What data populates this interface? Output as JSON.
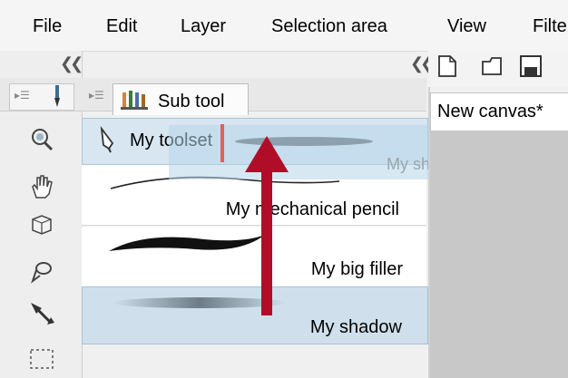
{
  "menu": {
    "file": "File",
    "edit": "Edit",
    "layer": "Layer",
    "selection_area": "Selection area",
    "view": "View",
    "filter": "Filte"
  },
  "subtool_panel": {
    "tab_label": "Sub tool",
    "toolset_label": "My toolset",
    "ghost_drag_label": "My shadow",
    "items": [
      {
        "label": "My mechanical pencil"
      },
      {
        "label": "My big filler"
      },
      {
        "label": "My shadow"
      }
    ]
  },
  "canvas": {
    "tab_label": "New canvas*"
  },
  "colors": {
    "selection_fill": "#cfe0ec",
    "toolset_fill": "#d7e6f1",
    "insert_marker": "#e0605f",
    "annotation_arrow": "#b00e28"
  },
  "icons": {
    "left_tools": [
      "zoom-icon",
      "hand-icon",
      "3d-object-icon",
      "lasso-icon",
      "move-icon",
      "selection-rect-icon"
    ]
  }
}
